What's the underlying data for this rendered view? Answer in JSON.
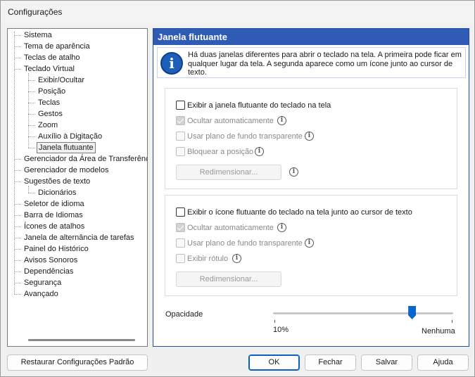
{
  "window": {
    "title": "Configurações"
  },
  "tree": {
    "items": [
      {
        "label": "Sistema",
        "level": 0
      },
      {
        "label": "Tema de aparência",
        "level": 0
      },
      {
        "label": "Teclas de atalho",
        "level": 0
      },
      {
        "label": "Teclado Virtual",
        "level": 0
      },
      {
        "label": "Exibir/Ocultar",
        "level": 1
      },
      {
        "label": "Posição",
        "level": 1
      },
      {
        "label": "Teclas",
        "level": 1
      },
      {
        "label": "Gestos",
        "level": 1
      },
      {
        "label": "Zoom",
        "level": 1
      },
      {
        "label": "Auxílio à Digitação",
        "level": 1
      },
      {
        "label": "Janela flutuante",
        "level": 1,
        "selected": true
      },
      {
        "label": "Gerenciador da Área de Transferência",
        "level": 0
      },
      {
        "label": "Gerenciador de modelos",
        "level": 0
      },
      {
        "label": "Sugestões de texto",
        "level": 0
      },
      {
        "label": "Dicionários",
        "level": 1
      },
      {
        "label": "Seletor de idioma",
        "level": 0
      },
      {
        "label": "Barra de Idiomas",
        "level": 0
      },
      {
        "label": "Ícones de atalhos",
        "level": 0
      },
      {
        "label": "Janela de alternância de tarefas",
        "level": 0
      },
      {
        "label": "Painel do Histórico",
        "level": 0
      },
      {
        "label": "Avisos Sonoros",
        "level": 0
      },
      {
        "label": "Dependências",
        "level": 0
      },
      {
        "label": "Segurança",
        "level": 0
      },
      {
        "label": "Avançado",
        "level": 0
      }
    ]
  },
  "panel": {
    "title": "Janela flutuante",
    "info_icon": "info-icon",
    "info_text": "Há duas janelas diferentes para abrir o teclado na tela. A primeira pode ficar em qualquer lugar da tela. A segunda aparece como um ícone junto ao cursor de texto.",
    "group1": {
      "main_label": "Exibir a janela flutuante do teclado na tela",
      "auto_hide_label": "Ocultar automaticamente",
      "transparent_label": "Usar plano de fundo transparente",
      "lock_label": "Bloquear a posição",
      "resize_label": "Redimensionar..."
    },
    "group2": {
      "main_label": "Exibir o ícone flutuante do teclado na tela junto ao cursor de texto",
      "auto_hide_label": "Ocultar automaticamente",
      "transparent_label": "Usar plano de fundo transparente",
      "show_label_label": "Exibir rótulo",
      "resize_label": "Redimensionar..."
    },
    "opacity": {
      "label": "Opacidade",
      "min_label": "10%",
      "max_label": "Nenhuma",
      "value_fraction": 0.77
    }
  },
  "buttons": {
    "restore": "Restaurar Configurações Padrão",
    "ok": "OK",
    "close": "Fechar",
    "save": "Salvar",
    "help": "Ajuda"
  },
  "colors": {
    "accent": "#2f5bb5",
    "slider": "#0a66cc"
  }
}
